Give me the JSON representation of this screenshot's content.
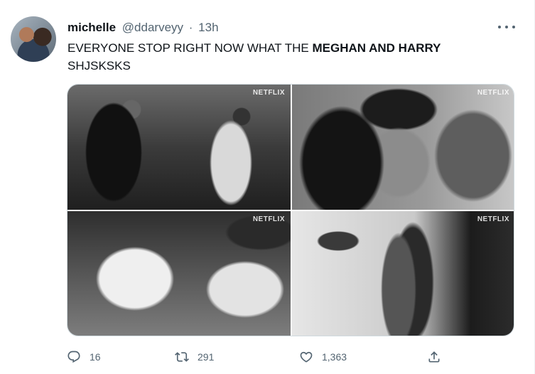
{
  "tweet": {
    "display_name": "michelle",
    "handle": "@ddarveyy",
    "separator": "·",
    "time": "13h",
    "text_plain": "EVERYONE STOP RIGHT NOW WHAT THE ",
    "text_bold": "MEGHAN AND HARRY",
    "text_line2": "SHJSKSKS",
    "media": [
      {
        "watermark": "NETFLIX"
      },
      {
        "watermark": "NETFLIX"
      },
      {
        "watermark": "NETFLIX"
      },
      {
        "watermark": "NETFLIX"
      }
    ],
    "actions": {
      "reply_count": "16",
      "retweet_count": "291",
      "like_count": "1,363"
    }
  },
  "icons": {
    "more": "more-horizontal-icon",
    "reply": "reply-icon",
    "retweet": "retweet-icon",
    "like": "heart-icon",
    "share": "share-icon"
  },
  "colors": {
    "text_primary": "#0f1419",
    "text_secondary": "#536471",
    "border": "#cfd9de"
  }
}
